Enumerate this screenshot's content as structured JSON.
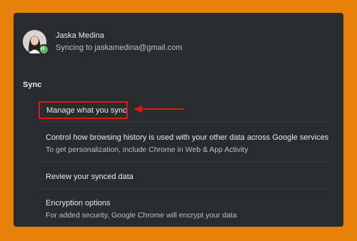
{
  "profile": {
    "name": "Jaska Medina",
    "status": "Syncing to jaskamedina@gmail.com"
  },
  "sync": {
    "title": "Sync",
    "manage_label": "Manage what you sync",
    "history_title": "Control how browsing history is used with your other data across Google services",
    "history_desc": "To get personalization, include Chrome in Web & App Activity",
    "review_label": "Review your synced data",
    "encryption_title": "Encryption options",
    "encryption_desc": "For added security, Google Chrome will encrypt your data"
  },
  "colors": {
    "background": "#e8810a",
    "panel": "#2a2b2e",
    "highlight": "#e01818",
    "sync_badge": "#5bb96f"
  },
  "icons": [
    "avatar",
    "sync-icon",
    "annotation-arrow"
  ]
}
